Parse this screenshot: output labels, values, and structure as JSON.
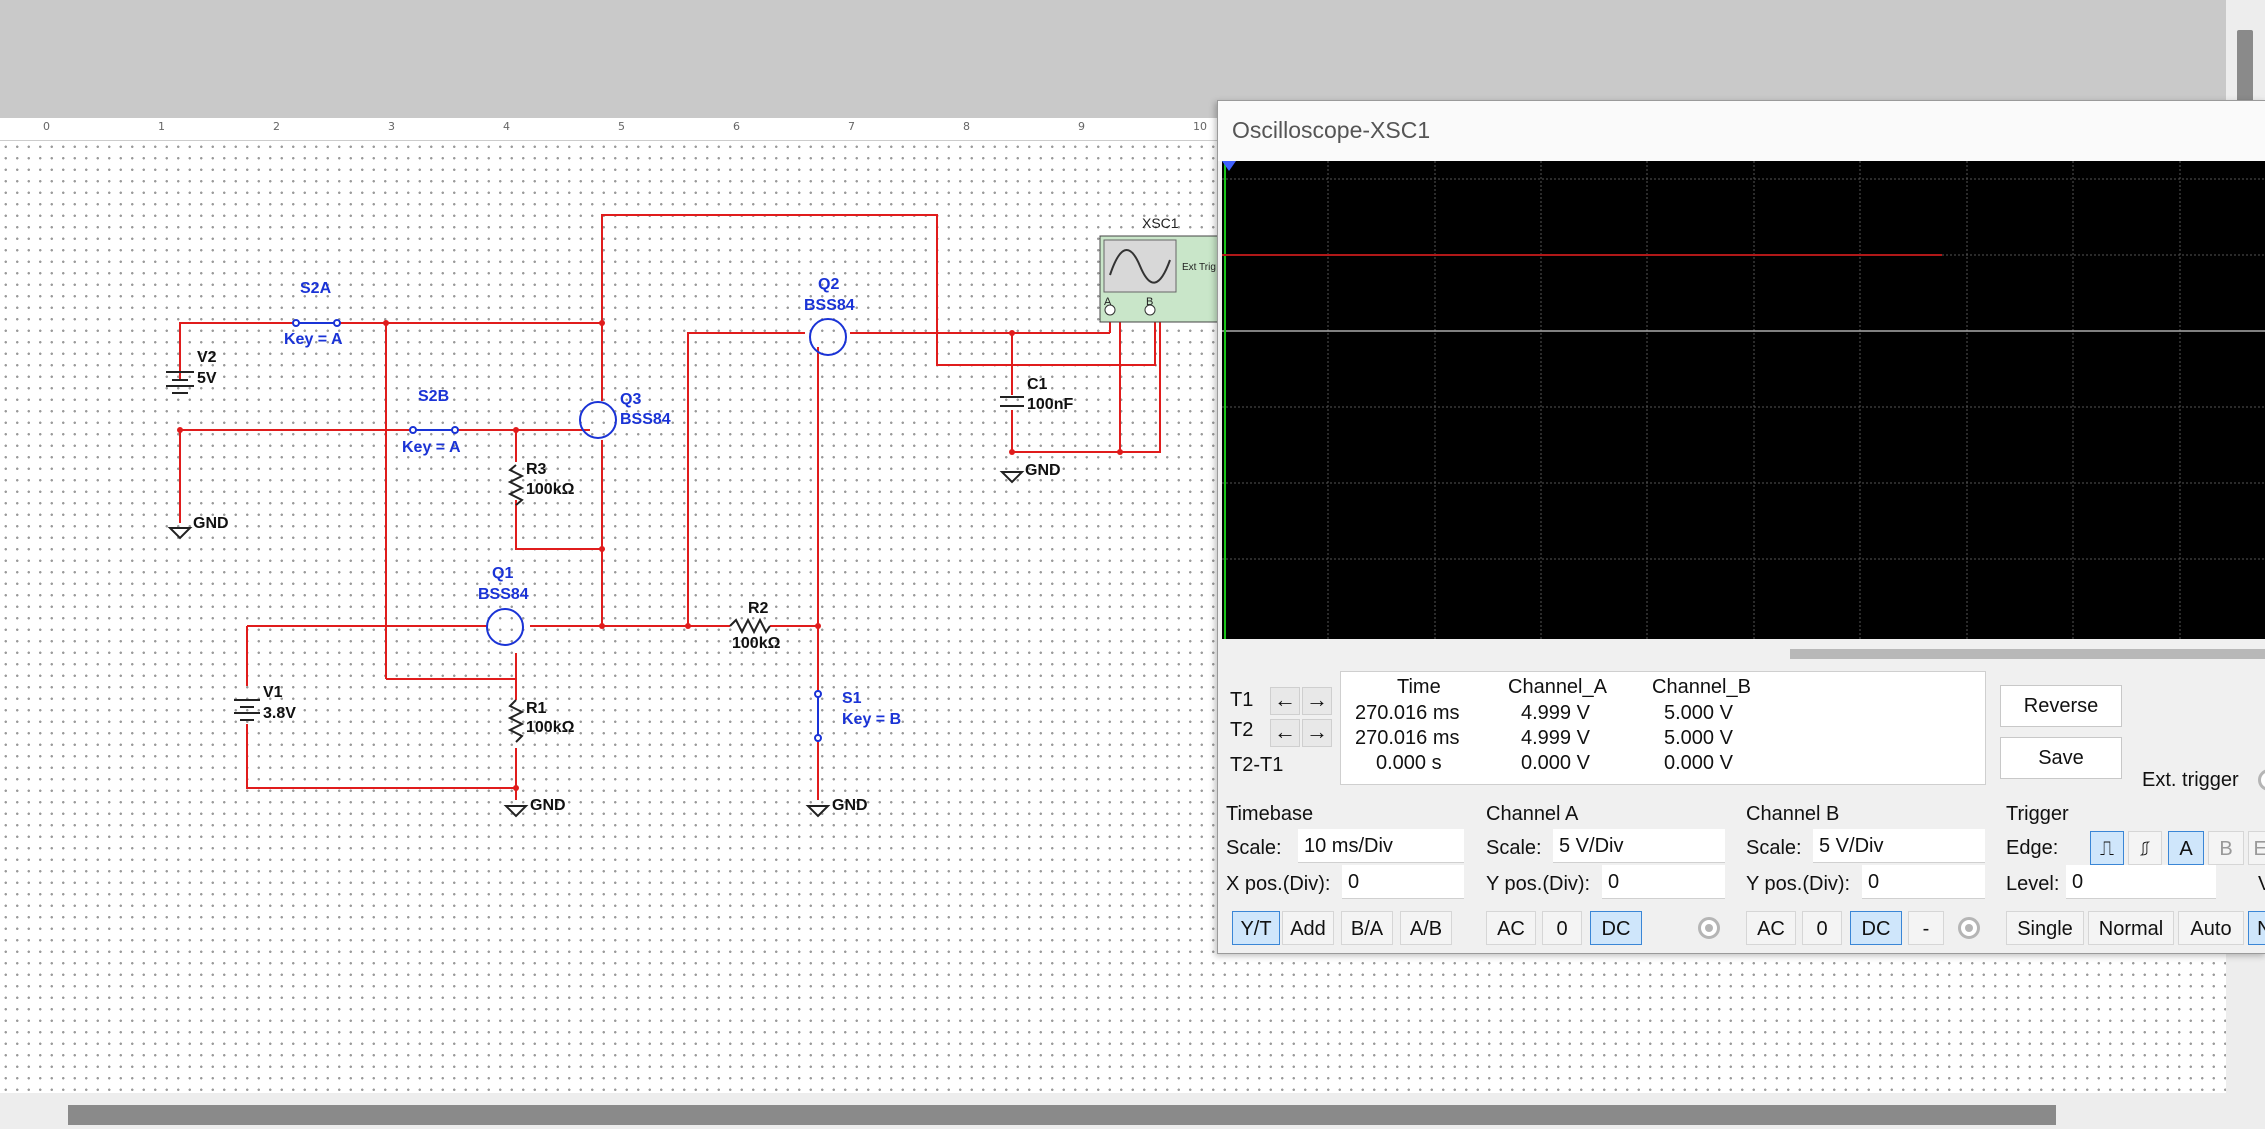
{
  "ruler": [
    "0",
    "1",
    "2",
    "3",
    "4",
    "5",
    "6",
    "7",
    "8",
    "9",
    "10"
  ],
  "circuit": {
    "s2a": {
      "name": "S2A",
      "key": "Key = A"
    },
    "s2b": {
      "name": "S2B",
      "key": "Key = A"
    },
    "v2": {
      "name": "V2",
      "value": "5V"
    },
    "v1": {
      "name": "V1",
      "value": "3.8V"
    },
    "q1": {
      "name": "Q1",
      "model": "BSS84"
    },
    "q2": {
      "name": "Q2",
      "model": "BSS84"
    },
    "q3": {
      "name": "Q3",
      "model": "BSS84"
    },
    "r1": {
      "name": "R1",
      "value": "100kΩ"
    },
    "r2": {
      "name": "R2",
      "value": "100kΩ"
    },
    "r3": {
      "name": "R3",
      "value": "100kΩ"
    },
    "c1": {
      "name": "C1",
      "value": "100nF"
    },
    "s1": {
      "name": "S1",
      "key": "Key = B"
    },
    "gnd": "GND",
    "xsc1": {
      "name": "XSC1",
      "ext_trig": "Ext Trig",
      "a": "A",
      "b": "B"
    }
  },
  "scope": {
    "title": "Oscilloscope-XSC1",
    "cursor": {
      "t1": "T1",
      "t2": "T2",
      "t2t1": "T2-T1",
      "headers": [
        "Time",
        "Channel_A",
        "Channel_B"
      ],
      "row_t1": [
        "270.016 ms",
        "4.999 V",
        "5.000 V"
      ],
      "row_t2": [
        "270.016 ms",
        "4.999 V",
        "5.000 V"
      ],
      "row_diff": [
        "0.000 s",
        "0.000 V",
        "0.000 V"
      ]
    },
    "reverse": "Reverse",
    "save": "Save",
    "ext_trigger": "Ext. trigger",
    "timebase": {
      "title": "Timebase",
      "scale_label": "Scale:",
      "scale": "10 ms/Div",
      "xpos_label": "X pos.(Div):",
      "xpos": "0",
      "modes": [
        "Y/T",
        "Add",
        "B/A",
        "A/B"
      ]
    },
    "channel_a": {
      "title": "Channel A",
      "scale_label": "Scale:",
      "scale": "5  V/Div",
      "ypos_label": "Y pos.(Div):",
      "ypos": "0",
      "coupling": [
        "AC",
        "0",
        "DC"
      ]
    },
    "channel_b": {
      "title": "Channel B",
      "scale_label": "Scale:",
      "scale": "5  V/Div",
      "ypos_label": "Y pos.(Div):",
      "ypos": "0",
      "coupling": [
        "AC",
        "0",
        "DC",
        "-"
      ]
    },
    "trigger": {
      "title": "Trigger",
      "edge_label": "Edge:",
      "level_label": "Level:",
      "level": "0",
      "level_unit": "V",
      "sources": [
        "A",
        "B",
        "Ext"
      ],
      "modes": [
        "Single",
        "Normal",
        "Auto",
        "None"
      ]
    }
  }
}
